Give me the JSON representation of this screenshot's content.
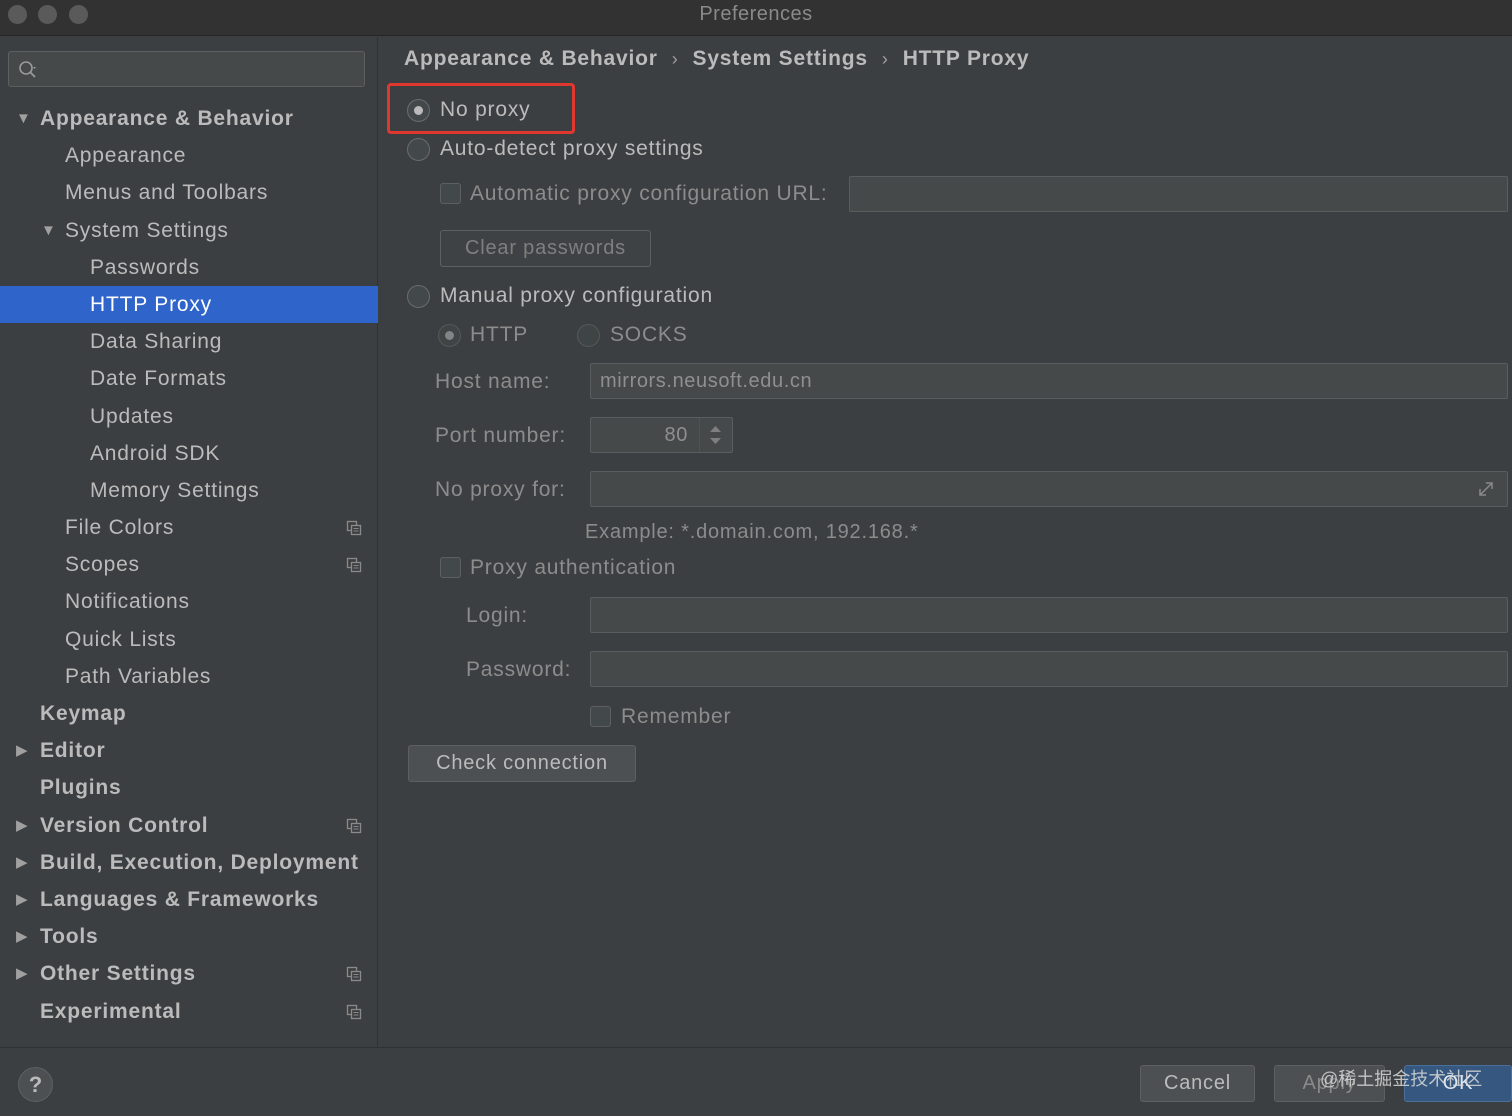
{
  "window": {
    "title": "Preferences"
  },
  "sidebar": {
    "search": {
      "value": "",
      "placeholder": ""
    },
    "items": [
      {
        "label": "Appearance & Behavior",
        "level": 0,
        "expanded": true,
        "bold": true
      },
      {
        "label": "Appearance",
        "level": 1
      },
      {
        "label": "Menus and Toolbars",
        "level": 1
      },
      {
        "label": "System Settings",
        "level": 1,
        "expanded": true
      },
      {
        "label": "Passwords",
        "level": 2
      },
      {
        "label": "HTTP Proxy",
        "level": 2,
        "selected": true
      },
      {
        "label": "Data Sharing",
        "level": 2
      },
      {
        "label": "Date Formats",
        "level": 2
      },
      {
        "label": "Updates",
        "level": 2
      },
      {
        "label": "Android SDK",
        "level": 2
      },
      {
        "label": "Memory Settings",
        "level": 2
      },
      {
        "label": "File Colors",
        "level": 1,
        "project_icon": true
      },
      {
        "label": "Scopes",
        "level": 1,
        "project_icon": true
      },
      {
        "label": "Notifications",
        "level": 1
      },
      {
        "label": "Quick Lists",
        "level": 1
      },
      {
        "label": "Path Variables",
        "level": 1
      },
      {
        "label": "Keymap",
        "level": 0,
        "bold": true
      },
      {
        "label": "Editor",
        "level": 0,
        "bold": true,
        "collapsed": true
      },
      {
        "label": "Plugins",
        "level": 0,
        "bold": true
      },
      {
        "label": "Version Control",
        "level": 0,
        "bold": true,
        "collapsed": true,
        "project_icon": true
      },
      {
        "label": "Build, Execution, Deployment",
        "level": 0,
        "bold": true,
        "collapsed": true
      },
      {
        "label": "Languages & Frameworks",
        "level": 0,
        "bold": true,
        "collapsed": true
      },
      {
        "label": "Tools",
        "level": 0,
        "bold": true,
        "collapsed": true
      },
      {
        "label": "Other Settings",
        "level": 0,
        "bold": true,
        "collapsed": true,
        "project_icon": true
      },
      {
        "label": "Experimental",
        "level": 0,
        "bold": true,
        "project_icon": true
      }
    ]
  },
  "breadcrumb": [
    "Appearance & Behavior",
    "System Settings",
    "HTTP Proxy"
  ],
  "proxy": {
    "no_proxy_label": "No proxy",
    "no_proxy_checked": true,
    "auto_detect_label": "Auto-detect proxy settings",
    "auto_config_url_label": "Automatic proxy configuration URL:",
    "auto_config_url_value": "",
    "clear_passwords_label": "Clear passwords",
    "manual_label": "Manual proxy configuration",
    "http_label": "HTTP",
    "socks_label": "SOCKS",
    "host_label": "Host name:",
    "host_value": "mirrors.neusoft.edu.cn",
    "port_label": "Port number:",
    "port_value": "80",
    "no_proxy_for_label": "No proxy for:",
    "no_proxy_for_value": "",
    "example_text": "Example: *.domain.com, 192.168.*",
    "proxy_auth_label": "Proxy authentication",
    "login_label": "Login:",
    "login_value": "",
    "password_label": "Password:",
    "password_value": "",
    "remember_label": "Remember",
    "check_connection_label": "Check connection"
  },
  "footer": {
    "help_label": "?",
    "cancel_label": "Cancel",
    "apply_label": "Apply",
    "ok_label": "OK",
    "watermark": "@稀土掘金技术社区"
  },
  "colors": {
    "background": "#3c3f41",
    "selection": "#2f65ca",
    "highlight_box": "#e0382e",
    "ok_button": "#365880"
  }
}
